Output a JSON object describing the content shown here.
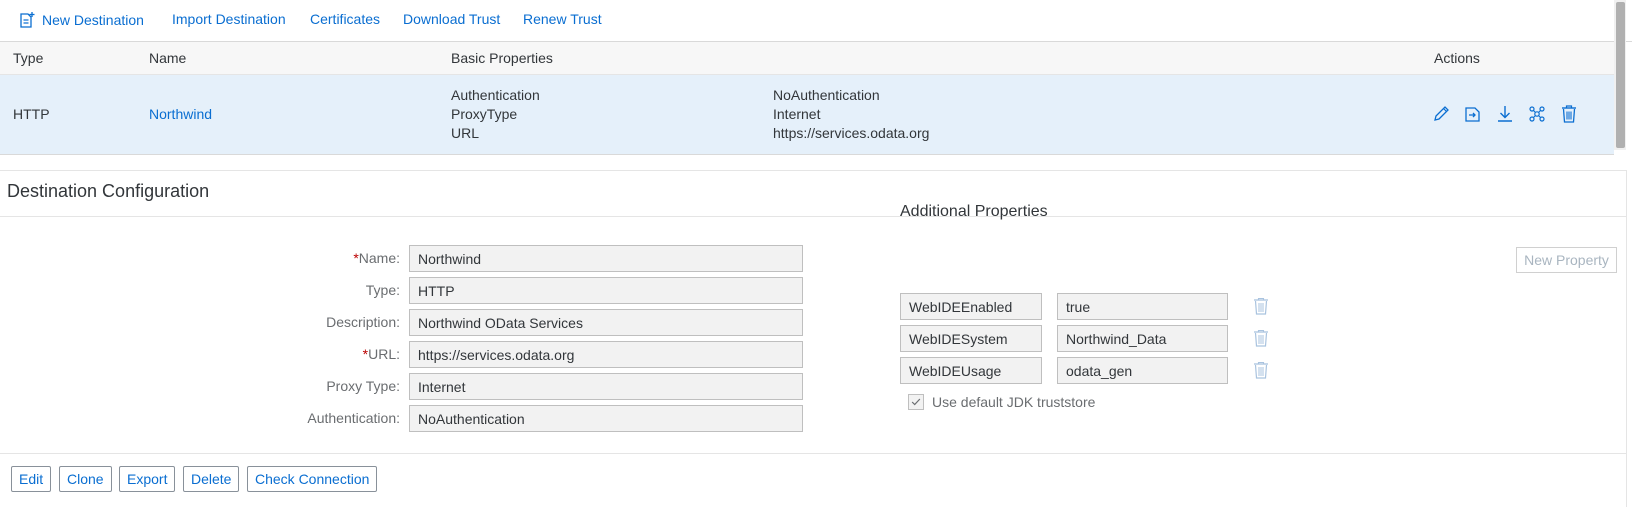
{
  "toolbar": {
    "new_destination": "New Destination",
    "import_destination": "Import Destination",
    "certificates": "Certificates",
    "download_trust": "Download Trust",
    "renew_trust": "Renew Trust"
  },
  "table": {
    "headers": {
      "type": "Type",
      "name": "Name",
      "basic_properties": "Basic Properties",
      "actions": "Actions"
    },
    "row": {
      "type": "HTTP",
      "name": "Northwind",
      "properties": [
        "Authentication",
        "ProxyType",
        "URL"
      ],
      "values": [
        "NoAuthentication",
        "Internet",
        "https://services.odata.org"
      ],
      "action_icons": [
        "edit-icon",
        "export-icon",
        "download-icon",
        "hierarchy-icon",
        "delete-icon"
      ]
    }
  },
  "config": {
    "title": "Destination Configuration",
    "fields": {
      "name_label": "Name:",
      "name_value": "Northwind",
      "type_label": "Type:",
      "type_value": "HTTP",
      "description_label": "Description:",
      "description_value": "Northwind OData Services",
      "url_label": "URL:",
      "url_value": "https://services.odata.org",
      "proxy_label": "Proxy Type:",
      "proxy_value": "Internet",
      "auth_label": "Authentication:",
      "auth_value": "NoAuthentication",
      "required_marker": "*"
    },
    "additional": {
      "title": "Additional Properties",
      "new_property": "New Property",
      "props": [
        {
          "key": "WebIDEEnabled",
          "value": "true"
        },
        {
          "key": "WebIDESystem",
          "value": "Northwind_Data"
        },
        {
          "key": "WebIDEUsage",
          "value": "odata_gen"
        }
      ],
      "truststore_label": "Use default JDK truststore",
      "truststore_checked": true
    },
    "buttons": {
      "edit": "Edit",
      "clone": "Clone",
      "export": "Export",
      "delete": "Delete",
      "check_connection": "Check Connection"
    }
  },
  "colors": {
    "accent": "#0a6ed1",
    "selected_row": "#e5f0fa",
    "required": "#bb0000"
  }
}
